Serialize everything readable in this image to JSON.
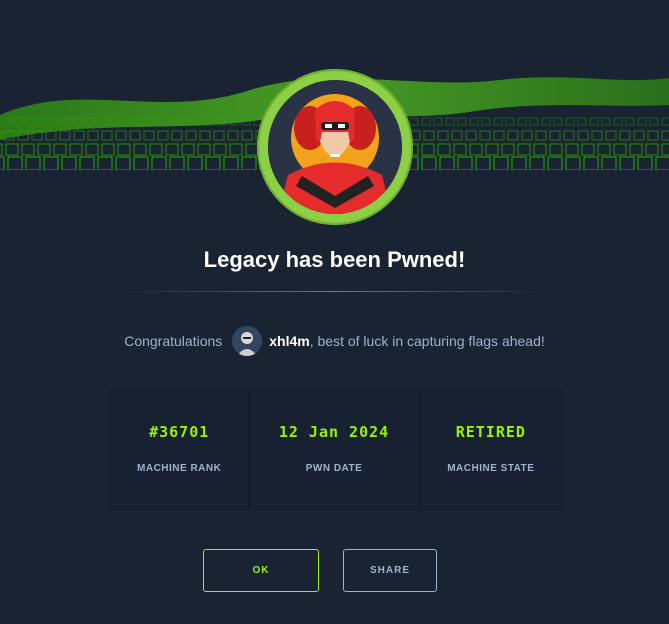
{
  "modal": {
    "title": "Legacy has been Pwned!",
    "congrats_prefix": "Congratulations",
    "username": "xhl4m",
    "congrats_suffix": ", best of luck in capturing flags ahead!"
  },
  "stats": [
    {
      "value": "#36701",
      "label": "MACHINE RANK"
    },
    {
      "value": "12 Jan 2024",
      "label": "PWN DATE"
    },
    {
      "value": "RETIRED",
      "label": "MACHINE STATE"
    }
  ],
  "buttons": {
    "ok_label": "OK",
    "share_label": "SHARE"
  },
  "colors": {
    "background": "#1a2332",
    "accent": "#9fef00",
    "avatar_ring": "#8dd045",
    "muted_text": "#a4b1cd"
  }
}
